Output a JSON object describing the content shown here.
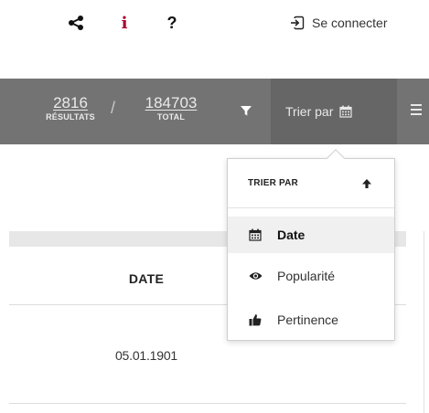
{
  "toolbar": {
    "info_glyph": "i",
    "help_glyph": "?",
    "flag_colors": [
      "#0f2f8a",
      "#ffffff",
      "#e1061e"
    ],
    "login_label": "Se connecter"
  },
  "results": {
    "count": "2816",
    "count_label": "RÉSULTATS",
    "separator": "/",
    "total": "184703",
    "total_label": "TOTAL",
    "sort_label": "Trier par"
  },
  "table": {
    "column_header": "DATE",
    "rows": [
      {
        "date": "05.01.1901"
      }
    ]
  },
  "sort_menu": {
    "title": "TRIER PAR",
    "items": [
      {
        "label": "Date",
        "icon": "calendar-icon",
        "active": true
      },
      {
        "label": "Popularité",
        "icon": "eye-icon",
        "active": false
      },
      {
        "label": "Pertinence",
        "icon": "thumbs-up-icon",
        "active": false
      }
    ]
  },
  "colors": {
    "bar": "#737373",
    "accent": "#a8002c"
  }
}
